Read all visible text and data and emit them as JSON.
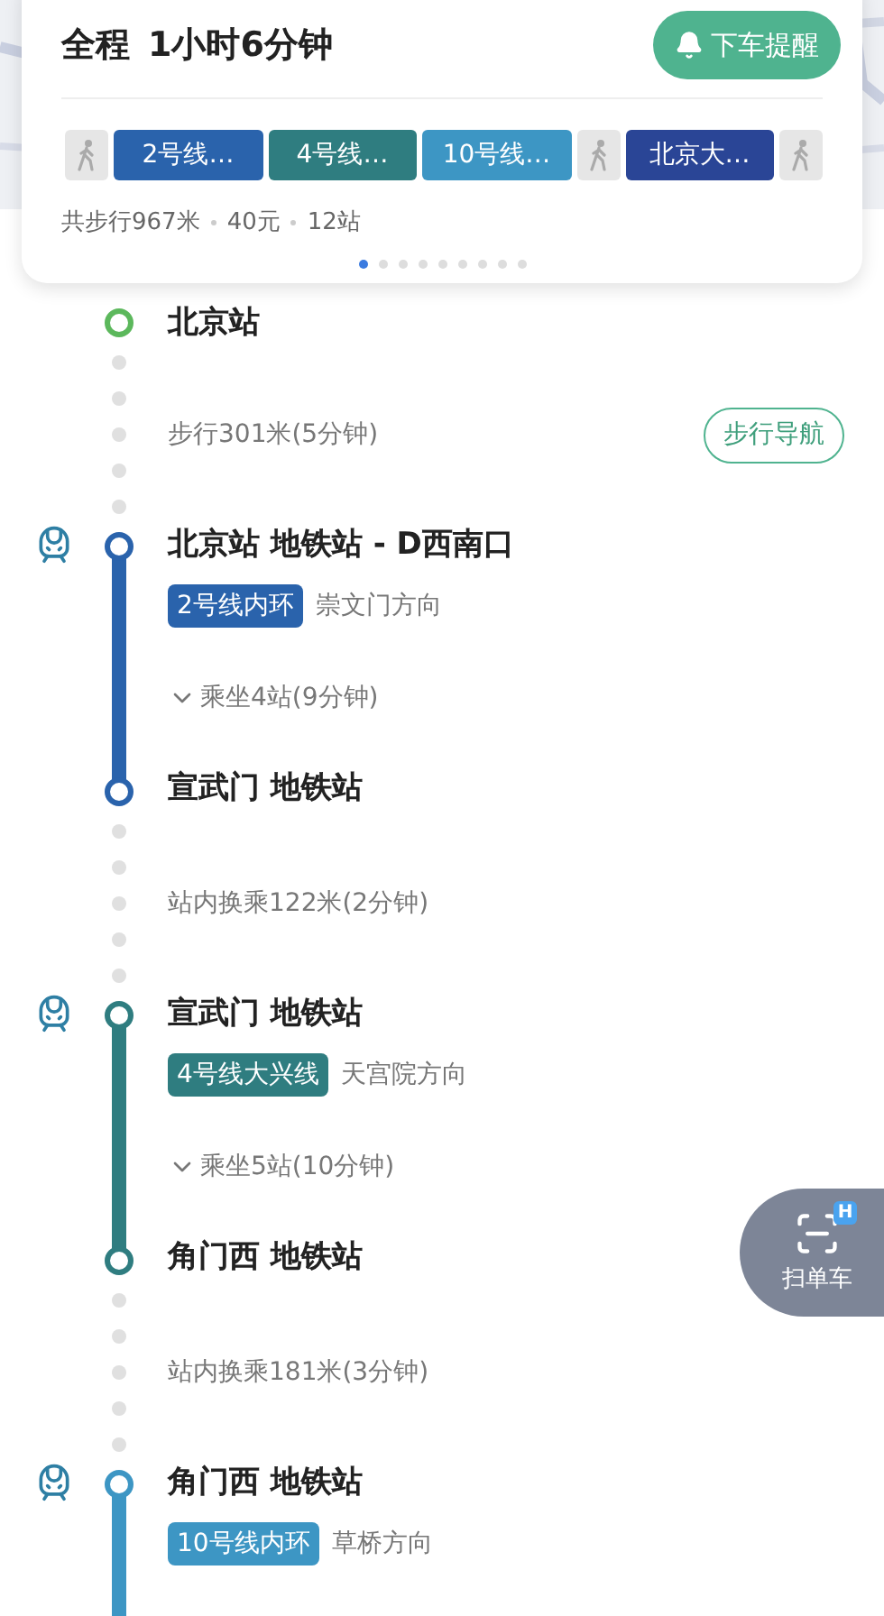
{
  "summary_card": {
    "label": "全程",
    "duration": "1小时6分钟",
    "remind_button": "下车提醒",
    "segments": [
      {
        "kind": "walk"
      },
      {
        "kind": "line",
        "label": "2号线…",
        "color": "#2a63ac"
      },
      {
        "kind": "line",
        "label": "4号线…",
        "color": "#2f7d80"
      },
      {
        "kind": "line",
        "label": "10号线…",
        "color": "#3d96c4"
      },
      {
        "kind": "walk"
      },
      {
        "kind": "line",
        "label": "北京大…",
        "color": "#2a4596"
      },
      {
        "kind": "walk"
      }
    ],
    "stats": [
      "共步行967米",
      "40元",
      "12站"
    ],
    "pages": [
      {
        "selected": true
      },
      {
        "selected": false
      },
      {
        "selected": false
      },
      {
        "selected": false
      },
      {
        "selected": false
      },
      {
        "selected": false
      },
      {
        "selected": false
      },
      {
        "selected": false
      },
      {
        "selected": false
      }
    ]
  },
  "steps": [
    {
      "kind": "start",
      "name": "北京站"
    },
    {
      "kind": "walk",
      "text": "步行301米(5分钟)",
      "button": "步行导航"
    },
    {
      "kind": "ride",
      "from": "北京站 地铁站 - D西南口",
      "line": "2号线内环",
      "color": "#2a63ac",
      "direction": "崇文门方向",
      "ride": "乘坐4站(9分钟)",
      "to": "宣武门 地铁站"
    },
    {
      "kind": "walk",
      "text": "站内换乘122米(2分钟)"
    },
    {
      "kind": "ride",
      "from": "宣武门 地铁站",
      "line": "4号线大兴线",
      "color": "#2f7d80",
      "direction": "天宫院方向",
      "ride": "乘坐5站(10分钟)",
      "to": "角门西 地铁站"
    },
    {
      "kind": "walk",
      "text": "站内换乘181米(3分钟)"
    },
    {
      "kind": "ride",
      "from": "角门西 地铁站",
      "line": "10号线内环",
      "color": "#3d96c4",
      "direction": "草桥方向"
    }
  ],
  "scan_button": {
    "label": "扫单车",
    "badge": "H"
  }
}
